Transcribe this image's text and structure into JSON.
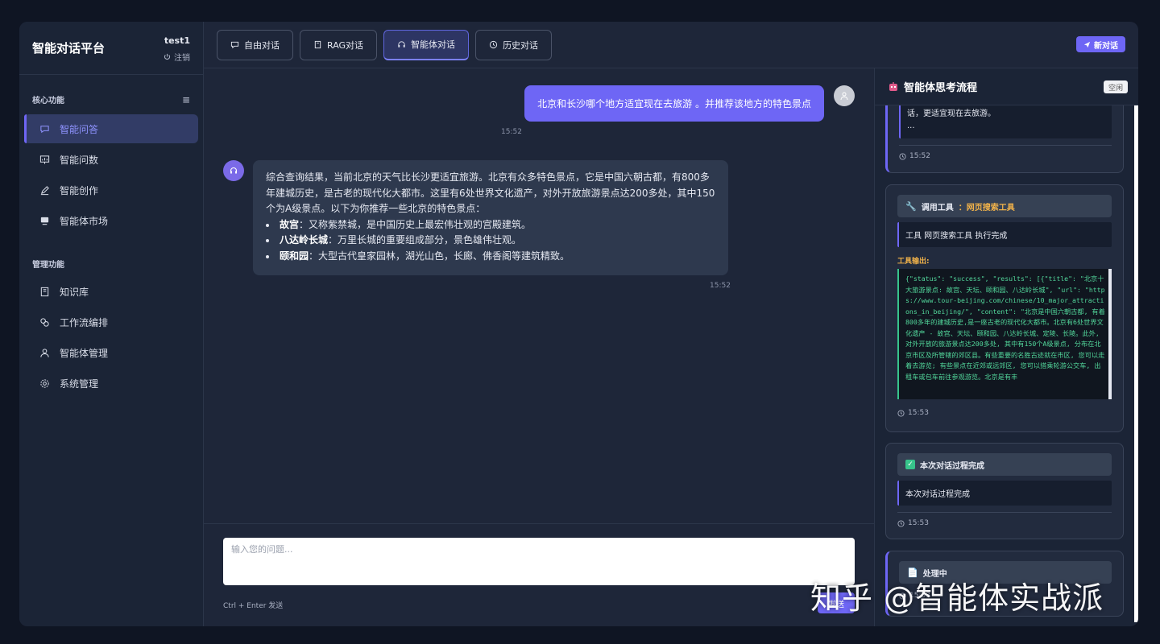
{
  "sidebar": {
    "brand": "智能对话平台",
    "user": "test1",
    "logout": "注销",
    "sections": [
      {
        "title": "核心功能",
        "items": [
          {
            "label": "智能问答",
            "icon": "chat-icon",
            "active": true
          },
          {
            "label": "智能问数",
            "icon": "chart-icon"
          },
          {
            "label": "智能创作",
            "icon": "pen-icon"
          },
          {
            "label": "智能体市场",
            "icon": "store-icon"
          }
        ]
      },
      {
        "title": "管理功能",
        "items": [
          {
            "label": "知识库",
            "icon": "book-icon"
          },
          {
            "label": "工作流编排",
            "icon": "workflow-icon"
          },
          {
            "label": "智能体管理",
            "icon": "user-icon"
          },
          {
            "label": "系统管理",
            "icon": "gear-icon"
          }
        ]
      }
    ]
  },
  "tabs": [
    {
      "label": "自由对话",
      "icon": "chat-icon"
    },
    {
      "label": "RAG对话",
      "icon": "book-icon"
    },
    {
      "label": "智能体对话",
      "icon": "headset-icon",
      "active": true
    },
    {
      "label": "历史对话",
      "icon": "clock-icon"
    }
  ],
  "new_chat": "新对话",
  "chat": {
    "user_message": "北京和长沙哪个地方适宜现在去旅游 。并推荐该地方的特色景点",
    "user_time": "15:52",
    "bot_intro": "综合查询结果，当前北京的天气比长沙更适宜旅游。北京有众多特色景点，它是中国六朝古都，有800多年建城历史，是古老的现代化大都市。这里有6处世界文化遗产，对外开放旅游景点达200多处，其中150个为A级景点。以下为你推荐一些北京的特色景点：",
    "bot_list": [
      {
        "name": "故宫",
        "desc": "：又称紫禁城，是中国历史上最宏伟壮观的宫殿建筑。"
      },
      {
        "name": "八达岭长城",
        "desc": "：万里长城的重要组成部分，景色雄伟壮观。"
      },
      {
        "name": "颐和园",
        "desc": "：大型古代皇家园林，湖光山色，长廊、佛香阁等建筑精致。"
      }
    ],
    "bot_time": "15:52",
    "input_placeholder": "输入您的问题...",
    "hint": "Ctrl + Enter 发送",
    "send_label": "发送"
  },
  "panel": {
    "title": "智能体思考流程",
    "status": "空闲",
    "card1": {
      "body_line1": "话，更适宜现在去旅游。",
      "body_line2": "...",
      "time": "15:52"
    },
    "card2": {
      "head_prefix": "调用工具",
      "tool_name": "：网页搜索工具",
      "body": "工具 网页搜索工具 执行完成",
      "output_label": "工具输出:",
      "output": "{\"status\": \"success\", \"results\": [{\"title\": \"北京十大旅游景点: 故宫、天坛、颐和园、八达岭长城\", \"url\": \"https://www.tour-beijing.com/chinese/10_major_attractions_in_beijing/\", \"content\": \"北京是中国六朝古都, 有着800多年的建城历史,是一座古老的现代化大都市。北京有6处世界文化遗产 - 故宫、天坛、颐和园、八达岭长城、定陵、长陵。此外, 对外开放的旅游景点达200多处, 其中有150个A级景点, 分布在北京市区及所管辖的郊区县。有些重要的名胜古迹就在市区, 您可以走着去游览; 有些景点在近郊或远郊区, 您可以搭乘轮游公交车, 出租车或包车前往参观游览。北京是有丰",
      "time": "15:53"
    },
    "card3": {
      "head": "本次对话过程完成",
      "body": "本次对话过程完成",
      "time": "15:53"
    },
    "card4": {
      "head": "处理中",
      "time": "15:53"
    }
  },
  "watermark": "知乎 @智能体实战派",
  "colors": {
    "accent": "#6e66f5",
    "tool_orange": "#f1b24a",
    "code_green": "#52d79b"
  }
}
